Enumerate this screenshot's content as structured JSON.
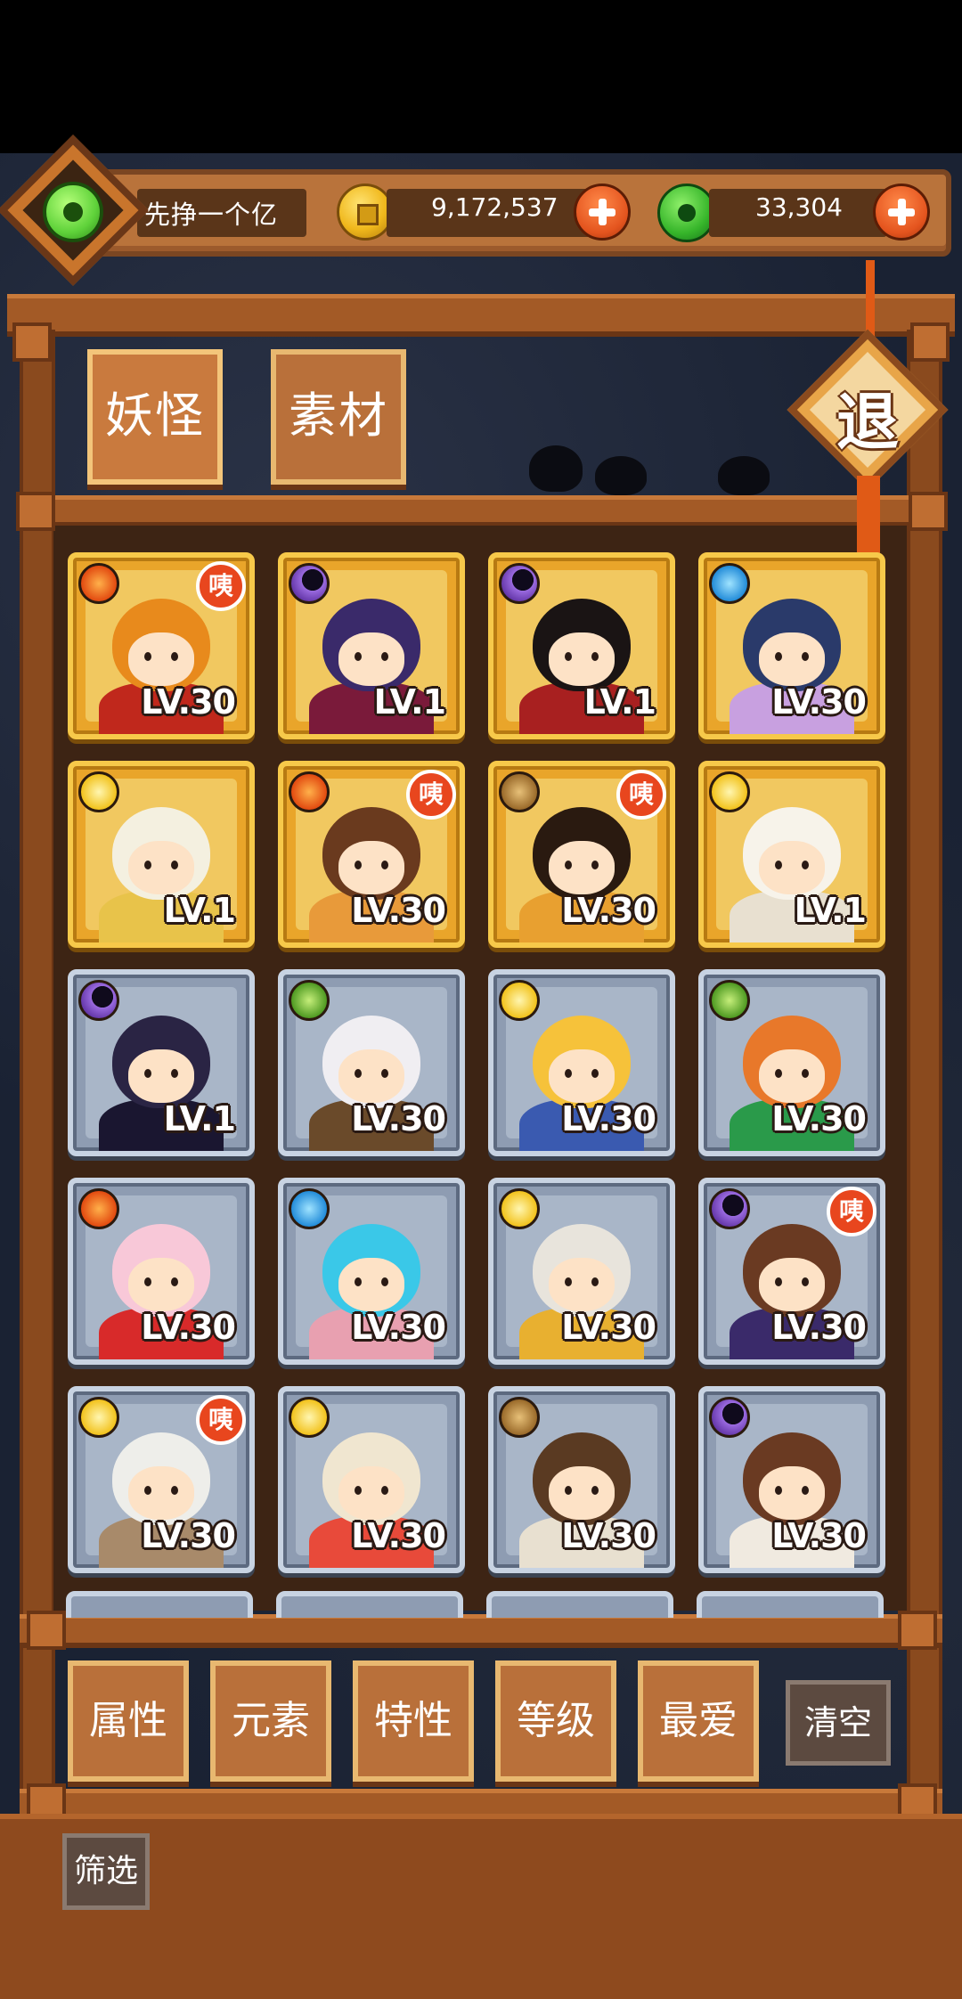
{
  "header": {
    "player_name": "先挣一个亿",
    "coins": "9,172,537",
    "jade": "33,304",
    "coin_icon": "gold-coin-icon",
    "jade_icon": "jade-disc-icon"
  },
  "tabs": [
    {
      "label": "妖怪",
      "active": true
    },
    {
      "label": "素材",
      "active": false
    }
  ],
  "exit_label": "退",
  "monsters": [
    {
      "level": "LV.30",
      "element": "fire",
      "frame": "gold",
      "badge": "咦",
      "hair": "#e88a1c",
      "outfit": "#c0281c"
    },
    {
      "level": "LV.1",
      "element": "dark",
      "frame": "gold",
      "badge": "",
      "hair": "#3a2a6a",
      "outfit": "#7a1a3a"
    },
    {
      "level": "LV.1",
      "element": "dark",
      "frame": "gold",
      "badge": "",
      "hair": "#1a1414",
      "outfit": "#a82020"
    },
    {
      "level": "LV.30",
      "element": "water",
      "frame": "gold",
      "badge": "",
      "hair": "#2a3a6a",
      "outfit": "#c8a0e0"
    },
    {
      "level": "LV.1",
      "element": "light",
      "frame": "gold",
      "badge": "",
      "hair": "#f4f0e0",
      "outfit": "#e8c34a"
    },
    {
      "level": "LV.30",
      "element": "fire",
      "frame": "gold",
      "badge": "咦",
      "hair": "#6a3a1e",
      "outfit": "#e89a3a"
    },
    {
      "level": "LV.30",
      "element": "earth",
      "frame": "gold",
      "badge": "咦",
      "hair": "#2a1a10",
      "outfit": "#e8a030"
    },
    {
      "level": "LV.1",
      "element": "light",
      "frame": "gold",
      "badge": "",
      "hair": "#f7f3ea",
      "outfit": "#e8e0d0"
    },
    {
      "level": "LV.1",
      "element": "dark",
      "frame": "silver",
      "badge": "",
      "hair": "#2a2444",
      "outfit": "#1a1630"
    },
    {
      "level": "LV.30",
      "element": "wood",
      "frame": "silver",
      "badge": "",
      "hair": "#f0eef2",
      "outfit": "#6a4a2a"
    },
    {
      "level": "LV.30",
      "element": "light",
      "frame": "silver",
      "badge": "",
      "hair": "#f6c23a",
      "outfit": "#3a5ab0"
    },
    {
      "level": "LV.30",
      "element": "wood",
      "frame": "silver",
      "badge": "",
      "hair": "#e8782a",
      "outfit": "#2a9a4a"
    },
    {
      "level": "LV.30",
      "element": "fire",
      "frame": "silver",
      "badge": "",
      "hair": "#f8c8d8",
      "outfit": "#d82a2a"
    },
    {
      "level": "LV.30",
      "element": "water",
      "frame": "silver",
      "badge": "",
      "hair": "#3ac8e8",
      "outfit": "#e8a0b0"
    },
    {
      "level": "LV.30",
      "element": "light",
      "frame": "silver",
      "badge": "",
      "hair": "#e8e4dc",
      "outfit": "#e8b030"
    },
    {
      "level": "LV.30",
      "element": "dark",
      "frame": "silver",
      "badge": "咦",
      "hair": "#6a3a22",
      "outfit": "#3a2a6a"
    },
    {
      "level": "LV.30",
      "element": "light",
      "frame": "silver",
      "badge": "咦",
      "hair": "#eeeeea",
      "outfit": "#a88a6a"
    },
    {
      "level": "LV.30",
      "element": "light",
      "frame": "silver",
      "badge": "",
      "hair": "#f0e6d0",
      "outfit": "#e84a3a"
    },
    {
      "level": "LV.30",
      "element": "earth",
      "frame": "silver",
      "badge": "",
      "hair": "#5a3a22",
      "outfit": "#e8e0d0"
    },
    {
      "level": "LV.30",
      "element": "dark",
      "frame": "silver",
      "badge": "",
      "hair": "#6a3a22",
      "outfit": "#f0eae0"
    }
  ],
  "filters": [
    "属性",
    "元素",
    "特性",
    "等级",
    "最爱"
  ],
  "clear_label": "清空",
  "screen_label": "筛选"
}
